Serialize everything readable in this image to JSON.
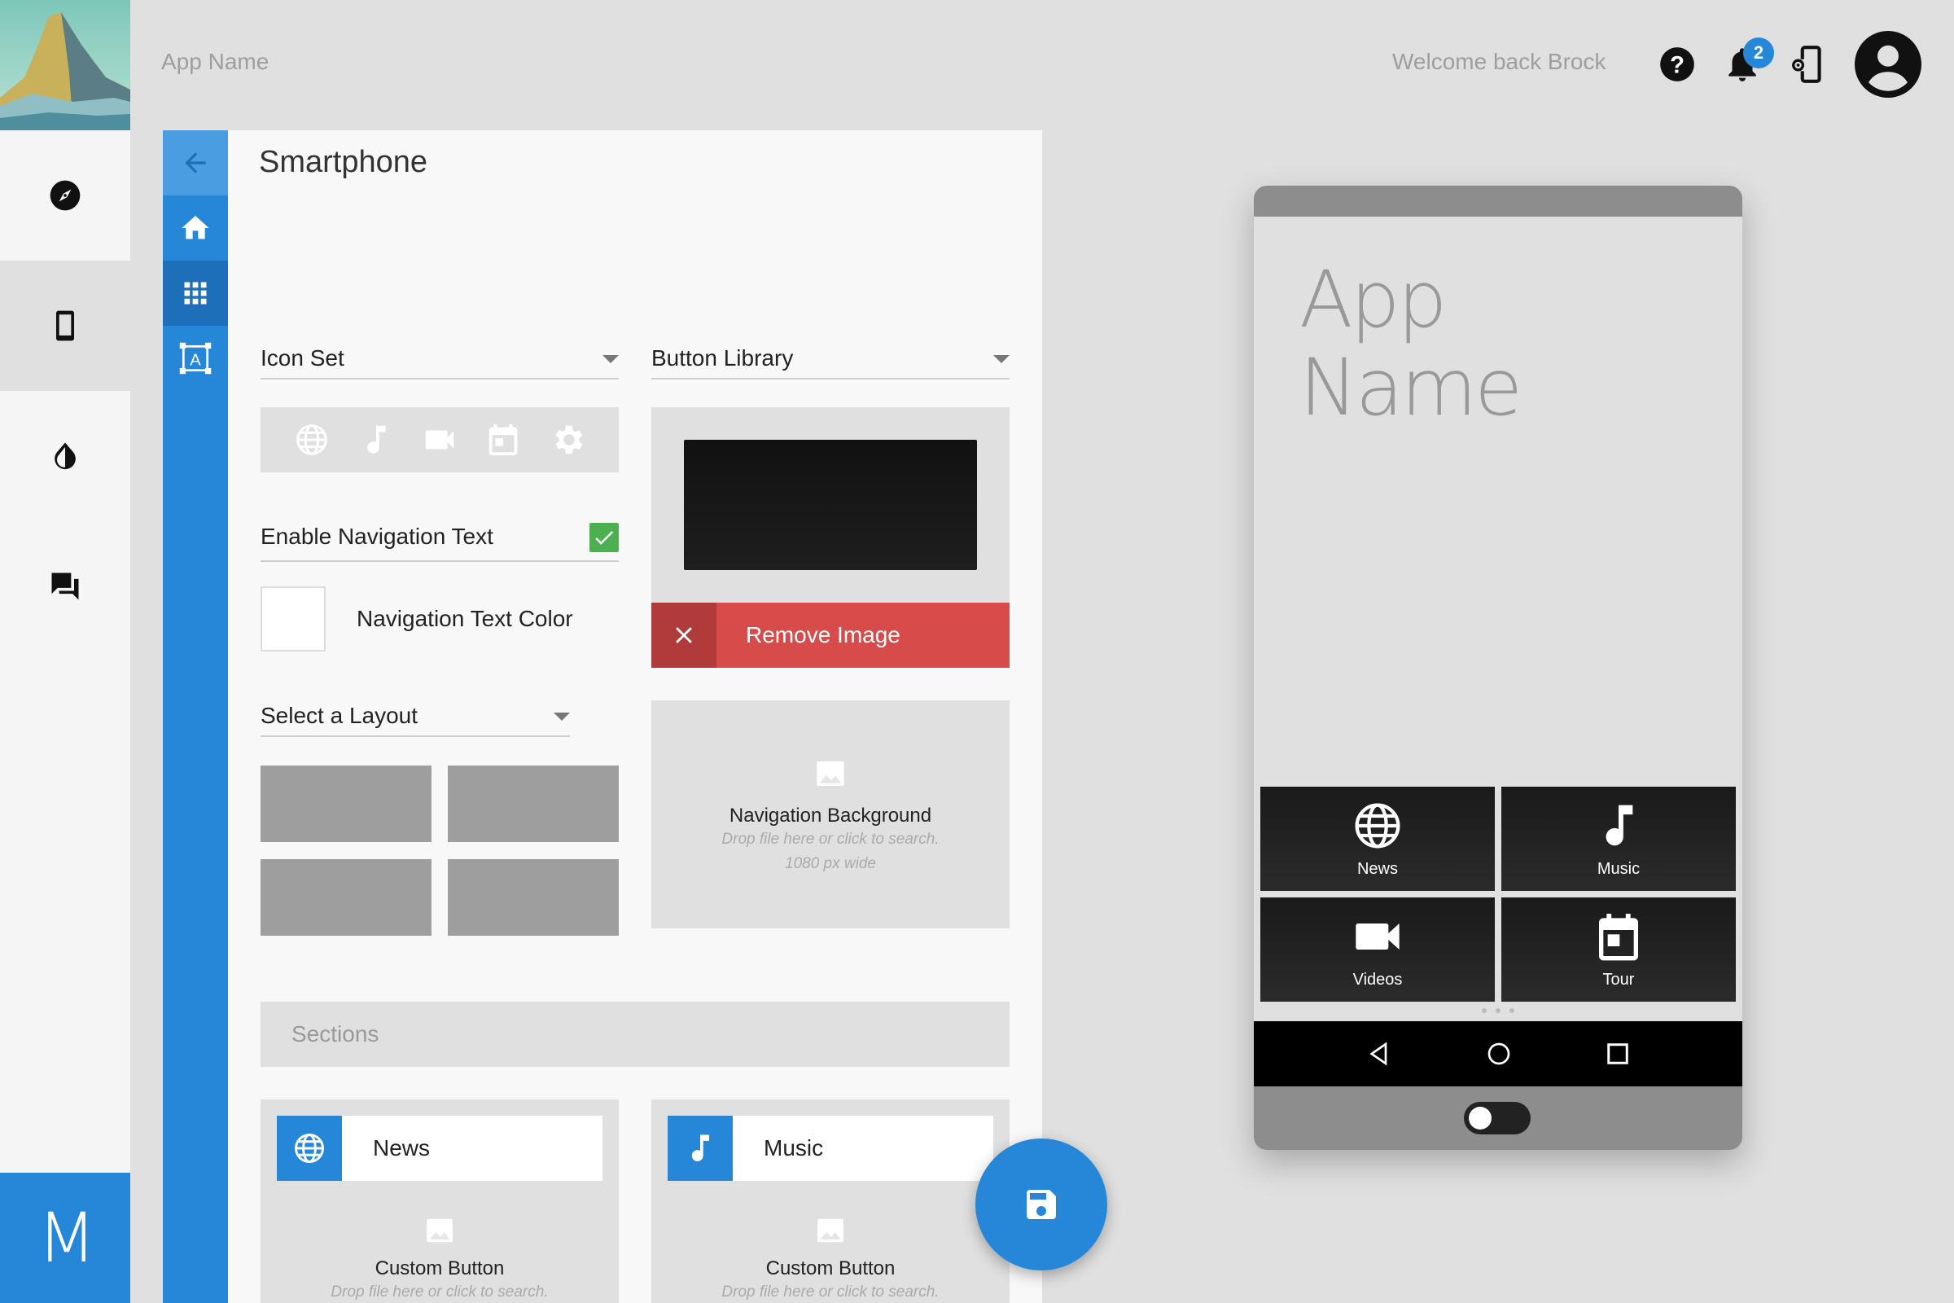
{
  "header": {
    "app_name": "App Name",
    "welcome": "Welcome back Brock",
    "notification_count": "2"
  },
  "rail": {
    "items": [
      "compass-icon",
      "smartphone-icon",
      "invert-colors-icon",
      "forum-icon"
    ],
    "active": "smartphone-icon",
    "brand_letter": "M"
  },
  "subnav": {
    "items": [
      "back-arrow-icon",
      "home-icon",
      "apps-grid-icon",
      "text-format-icon"
    ]
  },
  "panel": {
    "title": "Smartphone",
    "icon_set": {
      "label": "Icon Set",
      "icons": [
        "globe-icon",
        "music-note-icon",
        "videocam-icon",
        "calendar-icon",
        "gear-icon"
      ]
    },
    "navigation_text": {
      "label": "Enable Navigation Text",
      "checked": true
    },
    "navigation_text_color": {
      "label": "Navigation Text Color",
      "value": "#ffffff"
    },
    "layout": {
      "label": "Select a Layout"
    },
    "button_library": {
      "label": "Button Library",
      "remove_label": "Remove Image"
    },
    "navigation_background": {
      "title": "Navigation Background",
      "hint1": "Drop file here or click to search.",
      "hint2": "1080 px wide"
    },
    "sections": {
      "label": "Sections",
      "items": [
        {
          "name": "News",
          "icon": "globe-icon",
          "dropzone_title": "Custom Button",
          "dropzone_hint": "Drop file here or click to search."
        },
        {
          "name": "Music",
          "icon": "music-note-icon",
          "dropzone_title": "Custom Button",
          "dropzone_hint": "Drop file here or click to search."
        }
      ]
    }
  },
  "phone": {
    "app_name_line1": "App",
    "app_name_line2": "Name",
    "tiles": [
      {
        "label": "News",
        "icon": "globe-icon"
      },
      {
        "label": "Music",
        "icon": "music-note-icon"
      },
      {
        "label": "Videos",
        "icon": "videocam-icon"
      },
      {
        "label": "Tour",
        "icon": "calendar-icon"
      }
    ],
    "nav_buttons": [
      "back-triangle-icon",
      "home-circle-icon",
      "recents-square-icon"
    ],
    "toggle_on": false
  },
  "colors": {
    "accent": "#2687d8",
    "danger": "#d84b4b",
    "success": "#4caf50"
  }
}
